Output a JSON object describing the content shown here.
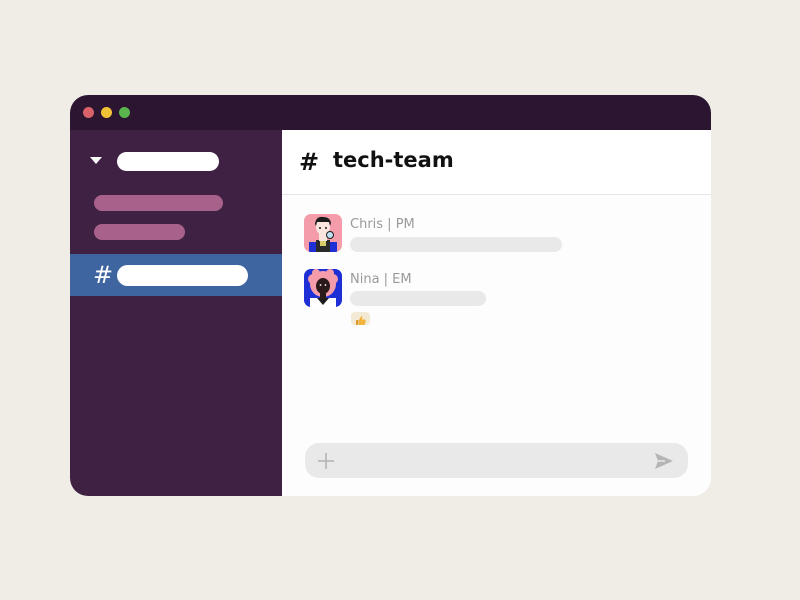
{
  "window": {
    "colors": {
      "titlebar": "#2b1530",
      "sidebar": "#3f2143",
      "active_channel": "#3e65a0",
      "section_bar": "#a8618a",
      "close": "#d9626a",
      "minimize": "#f2c236",
      "maximize": "#5bb54e"
    }
  },
  "sidebar": {
    "active_channel": {
      "prefix": "#"
    }
  },
  "channel": {
    "prefix": "#",
    "name": "tech-team"
  },
  "messages": [
    {
      "author": "Chris | PM",
      "avatar_bg": "#f59cab"
    },
    {
      "author": "Nina | EM",
      "avatar_bg": "#1f2fd6",
      "reaction": "👍"
    }
  ],
  "composer": {
    "icons": [
      "plus-icon",
      "send-icon"
    ]
  }
}
